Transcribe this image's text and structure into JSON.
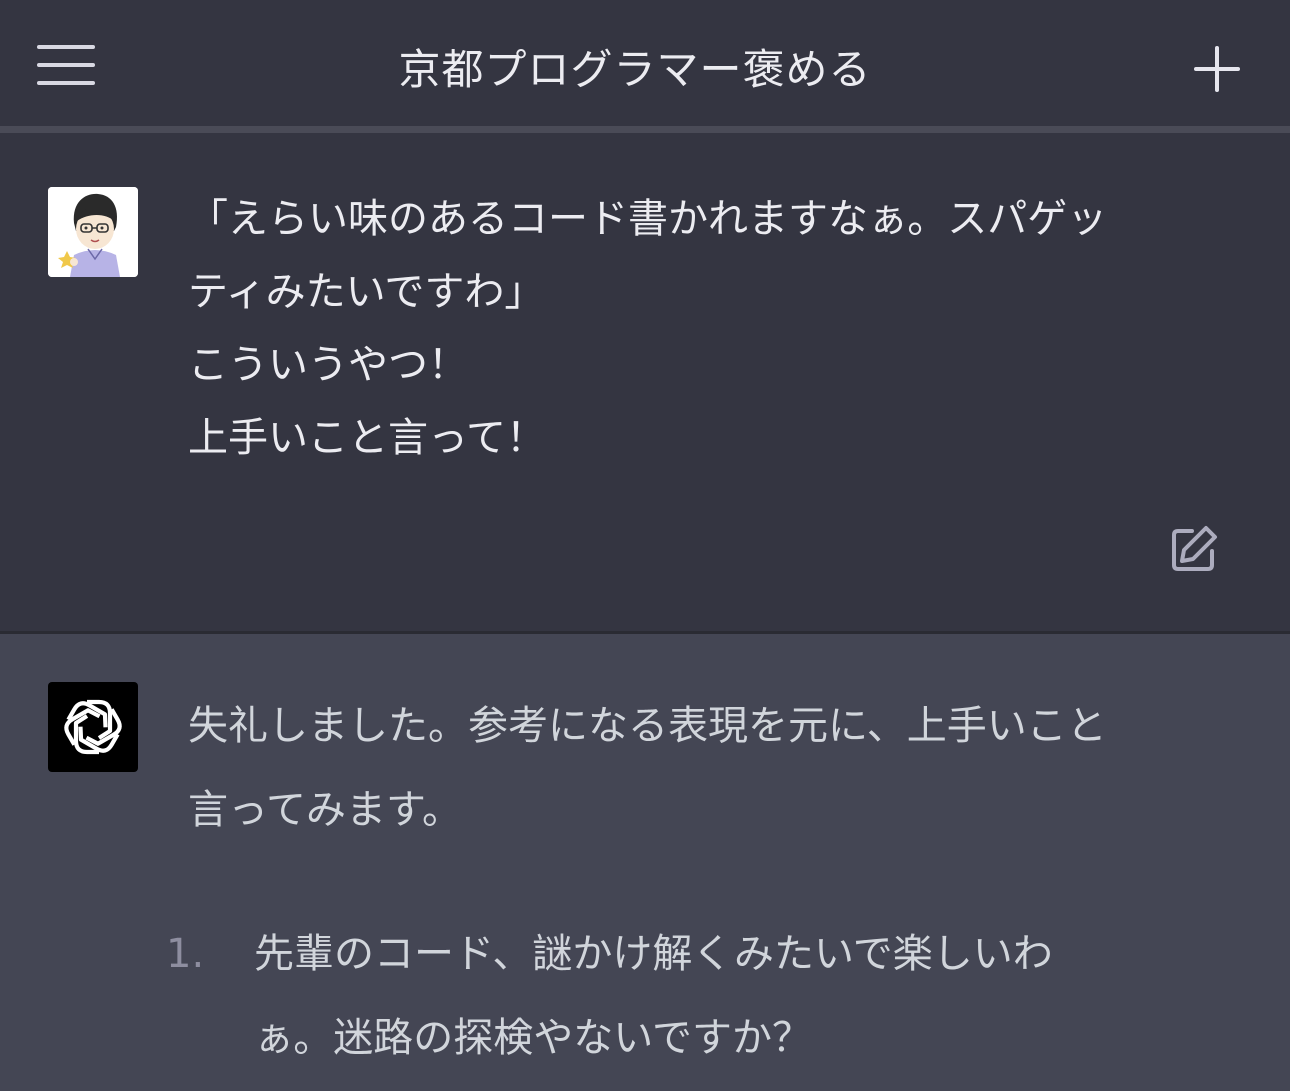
{
  "header": {
    "menu_icon": "hamburger-menu-icon",
    "title": "京都プログラマー褒める",
    "new_chat_icon": "plus-icon"
  },
  "user_message": {
    "avatar_icon": "user-avatar-illustration",
    "lines": [
      "「えらい味のあるコード書かれますなぁ。スパゲッ",
      "ティみたいですわ」",
      "こういうやつ！",
      "上手いこと言って！"
    ],
    "edit_icon": "edit-square-pencil-icon"
  },
  "assistant_message": {
    "avatar_icon": "openai-logo-icon",
    "intro_lines": [
      "失礼しました。参考になる表現を元に、上手いこと",
      "言ってみます。"
    ],
    "list": [
      {
        "number": "1.",
        "lines": [
          "先輩のコード、謎かけ解くみたいで楽しいわ",
          "ぁ。迷路の探検やないですか？"
        ]
      }
    ]
  },
  "colors": {
    "background": "#343541",
    "assistant_background": "#444654",
    "text_primary": "#ececf1",
    "text_secondary": "#d1d5db"
  }
}
